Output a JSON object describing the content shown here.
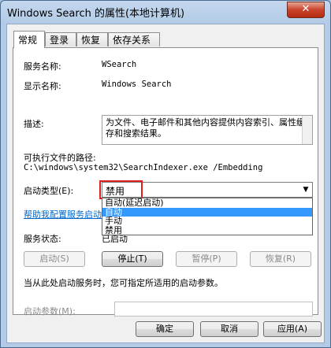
{
  "window": {
    "title": "Windows Search 的属性(本地计算机)",
    "close_label": "✕"
  },
  "tabs": [
    {
      "label": "常规"
    },
    {
      "label": "登录"
    },
    {
      "label": "恢复"
    },
    {
      "label": "依存关系"
    }
  ],
  "general": {
    "service_name_label": "服务名称:",
    "service_name_value": "WSearch",
    "display_name_label": "显示名称:",
    "display_name_value": "Windows Search",
    "description_label": "描述:",
    "description_value": "为文件、电子邮件和其他内容提供内容索引、属性缓存和搜索结果。",
    "exec_path_label": "可执行文件的路径:",
    "exec_path_value": "C:\\windows\\system32\\SearchIndexer.exe /Embedding",
    "startup_type_label": "启动类型(E):",
    "startup_type_value": "禁用",
    "startup_options": [
      "自动(延迟启动)",
      "自动",
      "手动",
      "禁用"
    ],
    "help_link": "帮助我配置服务启动选项。",
    "service_status_label": "服务状态:",
    "service_status_value": "已启动",
    "start_button": "启动(S)",
    "stop_button": "停止(T)",
    "pause_button": "暂停(P)",
    "resume_button": "恢复(R)",
    "hint_text": "当从此处启动服务时，您可指定所适用的启动参数。",
    "start_params_label": "启动参数(M):"
  },
  "footer": {
    "ok_button": "确定",
    "cancel_button": "取消",
    "apply_button": "应用(A)"
  }
}
